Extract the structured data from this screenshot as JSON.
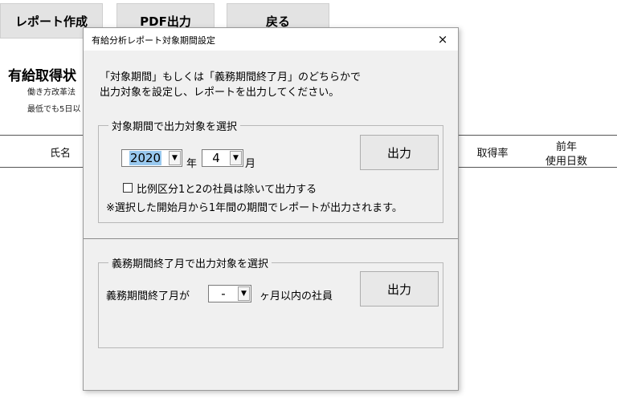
{
  "toolbar": {
    "report_create": "レポート作成",
    "pdf_output": "PDF出力",
    "back": "戻る"
  },
  "sheet": {
    "title_fragment": "有給取得状",
    "note1_fragment": "働き方改革法",
    "note2_fragment": "最低でも5日以",
    "col_name": "氏名",
    "col_rate": "取得率",
    "col_prev_line1": "前年",
    "col_prev_line2": "使用日数"
  },
  "dialog": {
    "title": "有給分析レポート対象期間設定",
    "close_glyph": "×",
    "intro_line1": "「対象期間」もしくは「義務期間終了月」のどちらかで",
    "intro_line2": "出力対象を設定し、レポートを出力してください。",
    "period_group": {
      "label": "対象期間で出力対象を選択",
      "year_value": "2020",
      "year_unit": "年",
      "month_value": "4",
      "month_unit": "月",
      "output_label": "出力",
      "exclude_checkbox_label": "比例区分1と2の社員は除いて出力する",
      "exclude_checked": false,
      "note": "※選択した開始月から1年間の期間でレポートが出力されます。"
    },
    "deadline_group": {
      "label": "義務期間終了月で出力対象を選択",
      "prefix": "義務期間終了月が",
      "months_value": "-",
      "suffix": "ヶ月以内の社員",
      "output_label": "出力"
    }
  }
}
